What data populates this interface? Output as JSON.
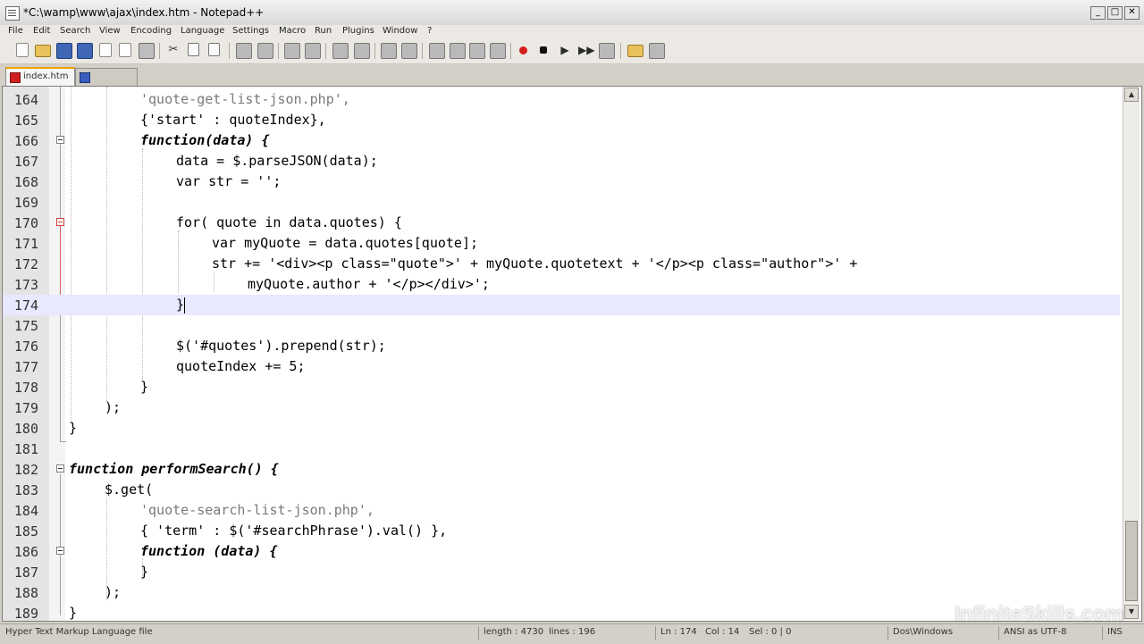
{
  "window": {
    "title": "*C:\\wamp\\www\\ajax\\index.htm - Notepad++",
    "minimize": "_",
    "maximize": "□",
    "close": "✕"
  },
  "menu": [
    "File",
    "Edit",
    "Search",
    "View",
    "Encoding",
    "Language",
    "Settings",
    "Macro",
    "Run",
    "Plugins",
    "Window",
    "?"
  ],
  "toolbar_icons": [
    "new-file-icon",
    "open-folder-icon",
    "save-icon",
    "save-all-icon",
    "close-icon",
    "close-all-icon",
    "print-icon",
    "cut-icon",
    "copy-icon",
    "paste-icon",
    "undo-icon",
    "redo-icon",
    "find-icon",
    "replace-icon",
    "zoom-in-icon",
    "zoom-out-icon",
    "sync-vertical-icon",
    "sync-horizontal-icon",
    "word-wrap-icon",
    "all-chars-icon",
    "indent-guide-icon",
    "user-lang-icon",
    "record-macro-icon",
    "stop-macro-icon",
    "play-macro-icon",
    "run-macro-multiple-icon",
    "save-macro-icon",
    "launch-in-browser-icon",
    "spellcheck-icon"
  ],
  "tabs": [
    {
      "label": "index.htm",
      "active": true
    },
    {
      "label": "",
      "active": false
    }
  ],
  "editor": {
    "lines": [
      {
        "num": "164",
        "code": "'quote-get-list-json.php',"
      },
      {
        "num": "165",
        "code": "{'start' : quoteIndex},"
      },
      {
        "num": "166",
        "code": "function(data) {"
      },
      {
        "num": "167",
        "code": "data = $.parseJSON(data);"
      },
      {
        "num": "168",
        "code": "var str = '';"
      },
      {
        "num": "169",
        "code": ""
      },
      {
        "num": "170",
        "code": "for( quote in data.quotes) {"
      },
      {
        "num": "171",
        "code": "var myQuote = data.quotes[quote];"
      },
      {
        "num": "172",
        "code": "str += '<div><p class=\"quote\">' + myQuote.quotetext + '</p><p class=\"author\">' + "
      },
      {
        "num": "173",
        "code": "myQuote.author + '</p></div>';"
      },
      {
        "num": "174",
        "code": "}"
      },
      {
        "num": "175",
        "code": ""
      },
      {
        "num": "176",
        "code": "$('#quotes').prepend(str);"
      },
      {
        "num": "177",
        "code": "quoteIndex += 5;"
      },
      {
        "num": "178",
        "code": "}"
      },
      {
        "num": "179",
        "code": ");"
      },
      {
        "num": "180",
        "code": "}"
      },
      {
        "num": "181",
        "code": ""
      },
      {
        "num": "182",
        "code": "function performSearch() {"
      },
      {
        "num": "183",
        "code": "$.get("
      },
      {
        "num": "184",
        "code": "'quote-search-list-json.php',"
      },
      {
        "num": "185",
        "code": "{ 'term' : $('#searchPhrase').val() },"
      },
      {
        "num": "186",
        "code": "function (data) {"
      },
      {
        "num": "187",
        "code": "}"
      },
      {
        "num": "188",
        "code": ");"
      },
      {
        "num": "189",
        "code": "}"
      }
    ],
    "current_line": "174"
  },
  "status": {
    "language": "Hyper Text Markup Language file",
    "length": "length : 4730",
    "lines": "lines : 196",
    "ln": "Ln : 174",
    "col": "Col : 14",
    "sel": "Sel : 0 | 0",
    "eol": "Dos\\Windows",
    "encoding": "ANSI as UTF-8",
    "mode": "INS"
  },
  "watermark": "InfiniteSkills.com",
  "colors": {
    "current_line_bg": "#e8e8ff",
    "string": "#7a7a7a",
    "fold_marker_active": "#d04040",
    "tab_accent": "#f0a000"
  }
}
